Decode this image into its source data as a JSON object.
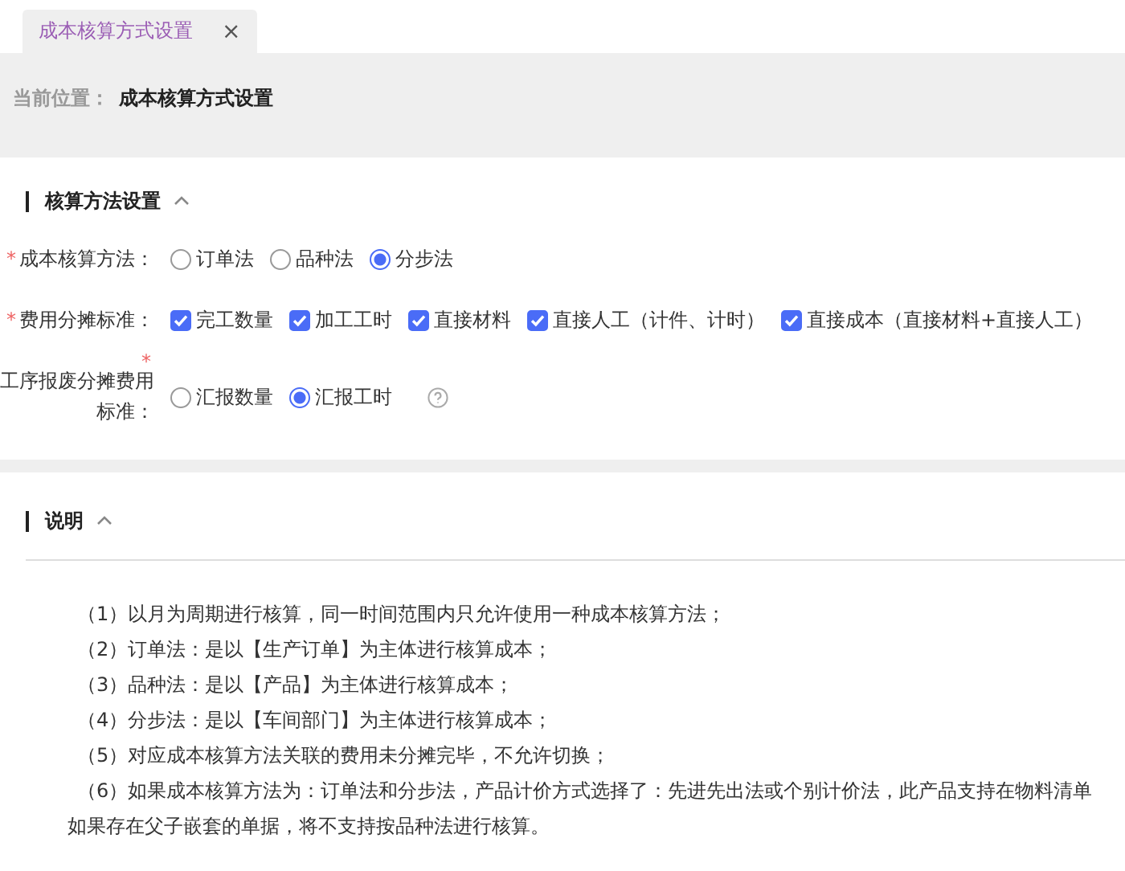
{
  "tabs": [
    {
      "label": "成本核算方式设置",
      "close": "×",
      "selected": true
    }
  ],
  "breadcrumb": {
    "label": "当前位置：",
    "current": "成本核算方式设置"
  },
  "section_settings": {
    "title": "核算方法设置",
    "expanded": true
  },
  "fields": [
    {
      "kind": "radio",
      "label": "成本核算方法：",
      "required": "*",
      "options": [
        {
          "label": "订单法",
          "selected": false
        },
        {
          "label": "品种法",
          "selected": false
        },
        {
          "label": "分步法",
          "selected": true
        }
      ]
    },
    {
      "kind": "checkbox",
      "label": "费用分摊标准：",
      "required": "*",
      "options": [
        {
          "label": "完工数量",
          "checked": true
        },
        {
          "label": "加工工时",
          "checked": true
        },
        {
          "label": "直接材料",
          "checked": true
        },
        {
          "label": "直接人工（计件、计时）",
          "checked": true
        },
        {
          "label": "直接成本（直接材料+直接人工）",
          "checked": true
        }
      ]
    },
    {
      "kind": "radio",
      "label": "工序报废分摊费用标准：",
      "required": "*",
      "help": true,
      "options": [
        {
          "label": "汇报数量",
          "selected": false
        },
        {
          "label": "汇报工时",
          "selected": true
        }
      ]
    }
  ],
  "section_notes": {
    "title": "说明",
    "expanded": true
  },
  "notes": [
    "（1）以月为周期进行核算，同一时间范围内只允许使用一种成本核算方法；",
    "（2）订单法：是以【生产订单】为主体进行核算成本；",
    "（3）品种法：是以【产品】为主体进行核算成本；",
    "（4）分步法：是以【车间部门】为主体进行核算成本；",
    "（5）对应成本核算方法关联的费用未分摊完毕，不允许切换；",
    "（6）如果成本核算方法为：订单法和分步法，产品计价方式选择了：先进先出法或个别计价法，此产品支持在物料清单",
    "如果存在父子嵌套的单据，将不支持按品种法进行核算。"
  ]
}
